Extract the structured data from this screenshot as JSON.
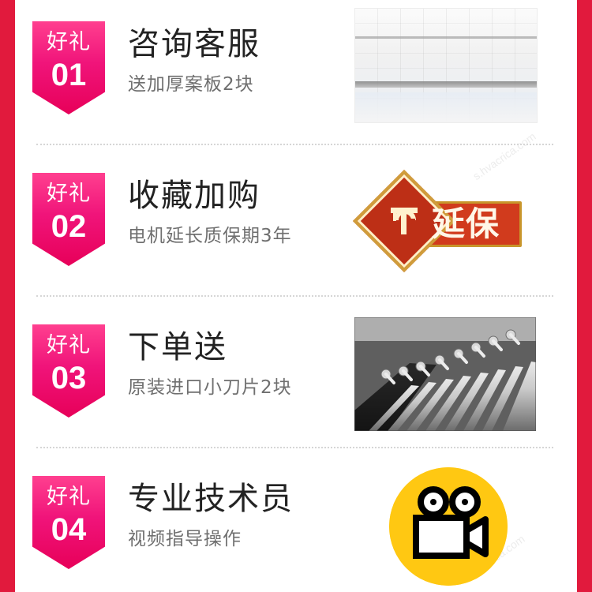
{
  "page": {
    "background": "#e11a3d",
    "panel_background": "#ffffff",
    "watermarks": [
      "s.hvacrica.com",
      "s.hvacrica.com",
      "s.hvacrica.com"
    ]
  },
  "items": [
    {
      "badge_title": "好礼",
      "badge_number": "01",
      "title": "咨询客服",
      "subtitle": "送加厚案板2块",
      "image_type": "cutting-board-photo"
    },
    {
      "badge_title": "好礼",
      "badge_number": "02",
      "title": "收藏加购",
      "subtitle": "电机延长质保期3年",
      "image_type": "warranty-badge",
      "image_text": "延保"
    },
    {
      "badge_title": "好礼",
      "badge_number": "03",
      "title": "下单送",
      "subtitle": "原装进口小刀片2块",
      "image_type": "blade-set-photo"
    },
    {
      "badge_title": "好礼",
      "badge_number": "04",
      "title": "专业技术员",
      "subtitle": "视频指导操作",
      "image_type": "video-camera-icon"
    }
  ]
}
